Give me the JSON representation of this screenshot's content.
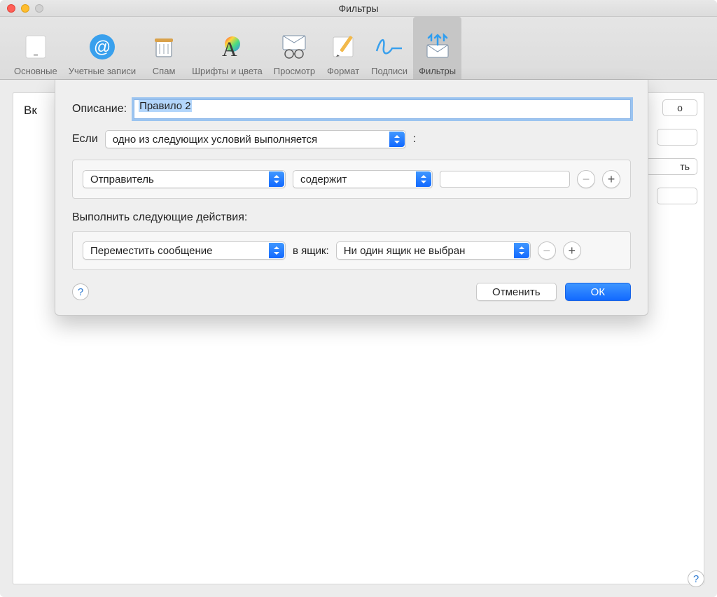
{
  "window": {
    "title": "Фильтры"
  },
  "toolbar": {
    "items": [
      {
        "label": "Основные"
      },
      {
        "label": "Учетные записи"
      },
      {
        "label": "Спам"
      },
      {
        "label": "Шрифты и цвета"
      },
      {
        "label": "Просмотр"
      },
      {
        "label": "Формат"
      },
      {
        "label": "Подписи"
      },
      {
        "label": "Фильтры"
      }
    ],
    "active_index": 7
  },
  "background": {
    "left_fragment": "Вк",
    "right_fragment_o": "о",
    "right_fragment_t": "ть"
  },
  "sheet": {
    "description_label": "Описание:",
    "description_value": "Правило 2",
    "if_label": "Если",
    "if_popup": "одно из следующих условий выполняется",
    "if_suffix": ":",
    "condition": {
      "field": "Отправитель",
      "operator": "содержит",
      "value": ""
    },
    "actions_label": "Выполнить следующие действия:",
    "action": {
      "type": "Переместить сообщение",
      "mailbox_label": "в ящик:",
      "mailbox_value": "Ни один ящик не выбран"
    },
    "help_glyph": "?",
    "cancel": "Отменить",
    "ok": "ОК"
  }
}
